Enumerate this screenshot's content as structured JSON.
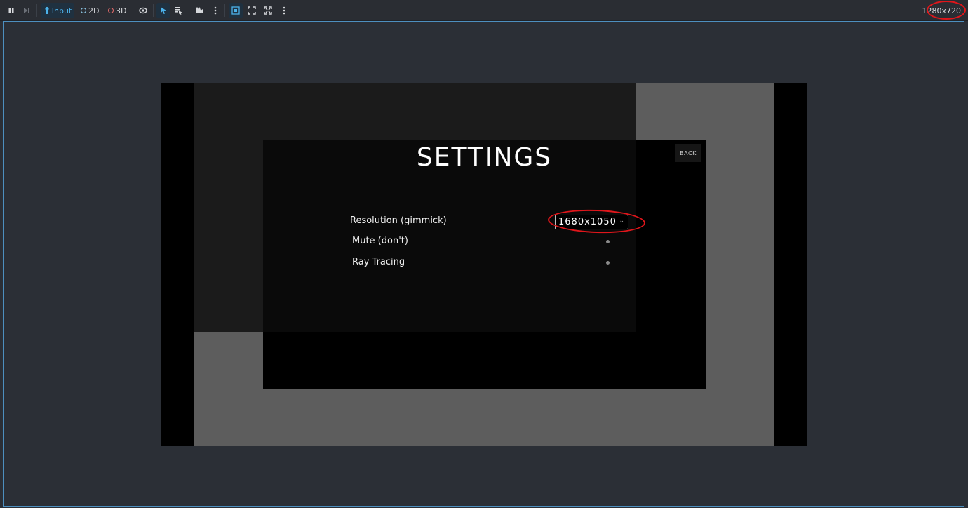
{
  "toolbar": {
    "input_label": "Input",
    "mode_2d": "2D",
    "mode_3d": "3D",
    "resolution": "1280x720",
    "colors": {
      "accent": "#4d8fbf",
      "input_active": "#1f3140",
      "dot_2d": "#8ec9e8",
      "dot_3d": "#e86c6c",
      "annotation": "#e0161b"
    }
  },
  "game": {
    "title": "SETTINGS",
    "back_label": "BACK",
    "settings": [
      {
        "label": "Resolution (gimmick)"
      },
      {
        "label": "Mute (don't)"
      },
      {
        "label": "Ray Tracing"
      }
    ],
    "resolution_value": "1680x1050"
  }
}
